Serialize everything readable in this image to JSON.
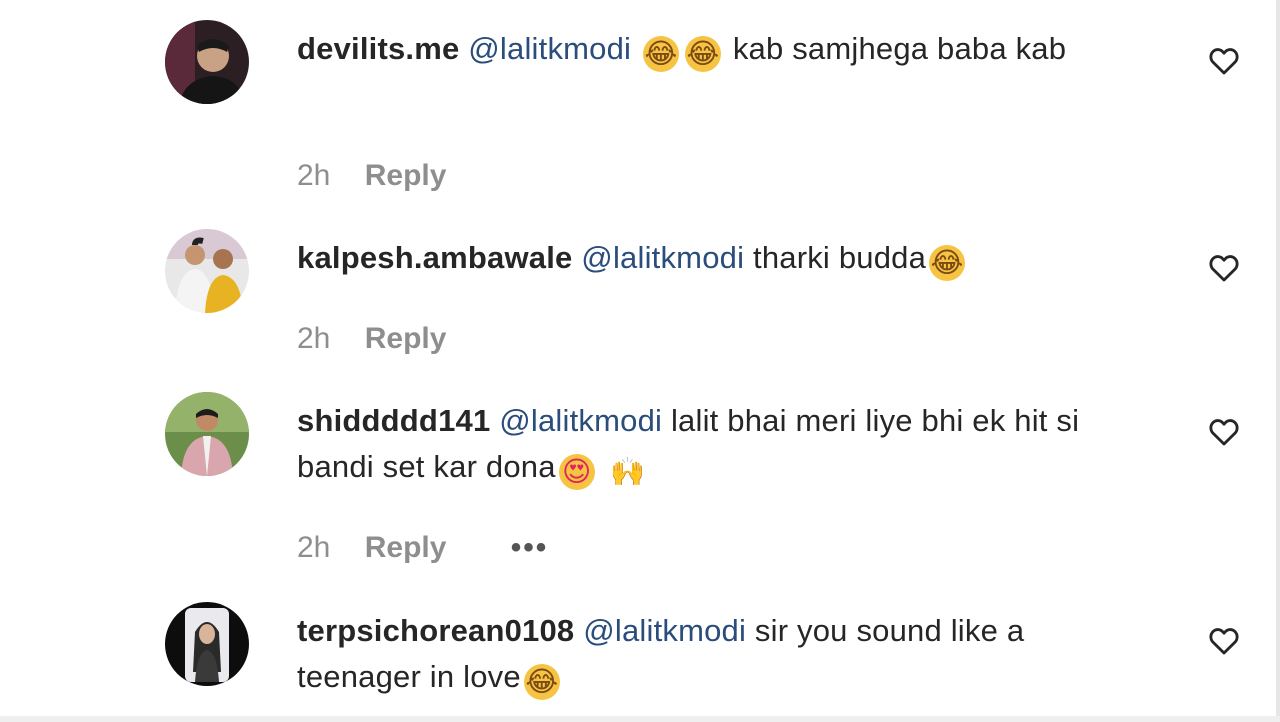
{
  "comments": [
    {
      "username": "devilits.me",
      "mention": "@lalitkmodi",
      "text_before": "",
      "emojis": [
        "😂",
        "😂"
      ],
      "text": "kab samjhega baba kab",
      "time": "2h",
      "reply": "Reply"
    },
    {
      "username": "kalpesh.ambawale",
      "mention": "@lalitkmodi",
      "text": "tharki budda",
      "emojis": [
        "😂"
      ],
      "time": "2h",
      "reply": "Reply"
    },
    {
      "username": "shiddddd141",
      "mention": "@lalitkmodi",
      "text": "lalit bhai meri liye bhi ek hit si bandi set kar dona",
      "emojis": [
        "😍",
        "🙌"
      ],
      "time": "2h",
      "reply": "Reply",
      "more": "•••"
    },
    {
      "username": "terpsichorean0108",
      "mention": "@lalitkmodi",
      "text": "sir you sound like a teenager in love",
      "emojis": [
        "😂"
      ]
    }
  ],
  "colors": {
    "mention": "#2a4d7c",
    "meta": "#8e8e8e",
    "text": "#262626"
  },
  "icons": {
    "like": "heart-outline-icon",
    "more": "more-options-icon"
  }
}
